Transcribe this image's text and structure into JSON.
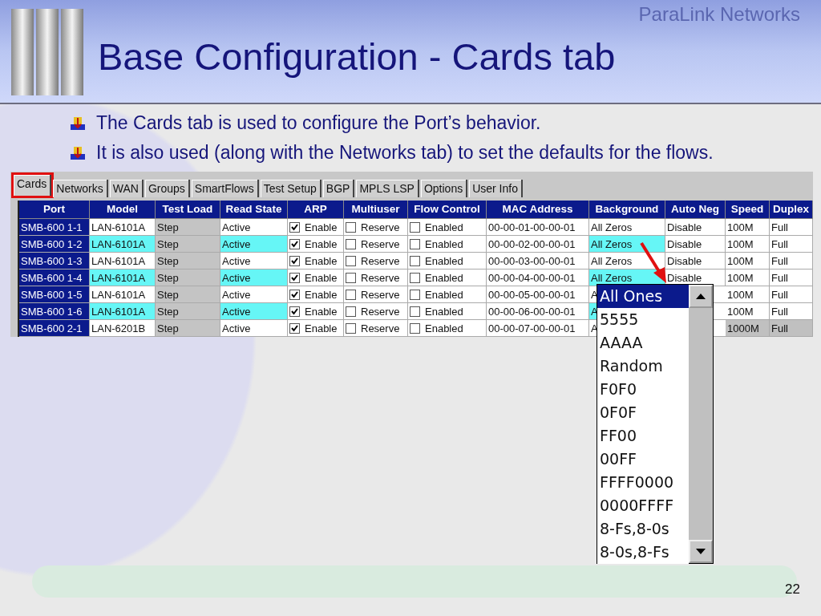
{
  "header": {
    "company": "ParaLink Networks",
    "title": "Base Configuration - Cards tab"
  },
  "bullets": [
    "The Cards tab is used to configure the Port’s behavior.",
    "It is also used (along with the Networks tab) to set the defaults for the flows."
  ],
  "app": {
    "tabs": [
      {
        "label": "Cards",
        "selected": true,
        "highlighted": true
      },
      {
        "label": "Networks",
        "selected": false,
        "highlighted": false
      },
      {
        "label": "WAN",
        "selected": false,
        "highlighted": false
      },
      {
        "label": "Groups",
        "selected": false,
        "highlighted": false
      },
      {
        "label": "SmartFlows",
        "selected": false,
        "highlighted": false
      },
      {
        "label": "Test Setup",
        "selected": false,
        "highlighted": false
      },
      {
        "label": "BGP",
        "selected": false,
        "highlighted": false
      },
      {
        "label": "MPLS LSP",
        "selected": false,
        "highlighted": false
      },
      {
        "label": "Options",
        "selected": false,
        "highlighted": false
      },
      {
        "label": "User Info",
        "selected": false,
        "highlighted": false
      }
    ],
    "table": {
      "columns": [
        "Port",
        "Model",
        "Test Load",
        "Read State",
        "ARP",
        "Multiuser",
        "Flow Control",
        "MAC Address",
        "Background",
        "Auto Neg",
        "Speed",
        "Duplex"
      ],
      "rows": [
        {
          "port": "SMB-600 1-1",
          "model": "LAN-6101A",
          "test_load": "Step",
          "read_state": "Active",
          "arp": {
            "checked": true,
            "label": "Enable"
          },
          "multiuser": {
            "checked": false,
            "label": "Reserve"
          },
          "flow_control": {
            "checked": false,
            "label": "Enabled"
          },
          "mac_address": "00-00-01-00-00-01",
          "background": "All Zeros",
          "auto_neg": "Disable",
          "speed": "100M",
          "duplex": "Full",
          "highlighted": false,
          "selected": false
        },
        {
          "port": "SMB-600 1-2",
          "model": "LAN-6101A",
          "test_load": "Step",
          "read_state": "Active",
          "arp": {
            "checked": true,
            "label": "Enable"
          },
          "multiuser": {
            "checked": false,
            "label": "Reserve"
          },
          "flow_control": {
            "checked": false,
            "label": "Enabled"
          },
          "mac_address": "00-00-02-00-00-01",
          "background": "All Zeros",
          "auto_neg": "Disable",
          "speed": "100M",
          "duplex": "Full",
          "highlighted": true,
          "selected": false
        },
        {
          "port": "SMB-600 1-3",
          "model": "LAN-6101A",
          "test_load": "Step",
          "read_state": "Active",
          "arp": {
            "checked": true,
            "label": "Enable"
          },
          "multiuser": {
            "checked": false,
            "label": "Reserve"
          },
          "flow_control": {
            "checked": false,
            "label": "Enabled"
          },
          "mac_address": "00-00-03-00-00-01",
          "background": "All Zeros",
          "auto_neg": "Disable",
          "speed": "100M",
          "duplex": "Full",
          "highlighted": false,
          "selected": false
        },
        {
          "port": "SMB-600 1-4",
          "model": "LAN-6101A",
          "test_load": "Step",
          "read_state": "Active",
          "arp": {
            "checked": true,
            "label": "Enable"
          },
          "multiuser": {
            "checked": false,
            "label": "Reserve"
          },
          "flow_control": {
            "checked": false,
            "label": "Enabled"
          },
          "mac_address": "00-00-04-00-00-01",
          "background": "All Zeros",
          "auto_neg": "Disable",
          "speed": "100M",
          "duplex": "Full",
          "highlighted": true,
          "selected": false
        },
        {
          "port": "SMB-600 1-5",
          "model": "LAN-6101A",
          "test_load": "Step",
          "read_state": "Active",
          "arp": {
            "checked": true,
            "label": "Enable"
          },
          "multiuser": {
            "checked": false,
            "label": "Reserve"
          },
          "flow_control": {
            "checked": false,
            "label": "Enabled"
          },
          "mac_address": "00-00-05-00-00-01",
          "background": "A",
          "speed": "100M",
          "duplex": "Full",
          "highlighted": false,
          "selected": false
        },
        {
          "port": "SMB-600 1-6",
          "model": "LAN-6101A",
          "test_load": "Step",
          "read_state": "Active",
          "arp": {
            "checked": true,
            "label": "Enable"
          },
          "multiuser": {
            "checked": false,
            "label": "Reserve"
          },
          "flow_control": {
            "checked": false,
            "label": "Enabled"
          },
          "mac_address": "00-00-06-00-00-01",
          "background": "A",
          "speed": "100M",
          "duplex": "Full",
          "highlighted": true,
          "selected": false
        },
        {
          "port": "SMB-600 2-1",
          "model": "LAN-6201B",
          "test_load": "Step",
          "read_state": "Active",
          "arp": {
            "checked": true,
            "label": "Enable"
          },
          "multiuser": {
            "checked": false,
            "label": "Reserve"
          },
          "flow_control": {
            "checked": false,
            "label": "Enabled"
          },
          "mac_address": "00-00-07-00-00-01",
          "background": "A",
          "speed": "1000M",
          "duplex": "Full",
          "highlighted": false,
          "selected": true
        }
      ]
    },
    "dropdown": {
      "items": [
        {
          "label": "All Ones",
          "selected": true
        },
        {
          "label": "5555",
          "selected": false
        },
        {
          "label": "AAAA",
          "selected": false
        },
        {
          "label": "Random",
          "selected": false
        },
        {
          "label": "F0F0",
          "selected": false
        },
        {
          "label": "0F0F",
          "selected": false
        },
        {
          "label": "FF00",
          "selected": false
        },
        {
          "label": "00FF",
          "selected": false
        },
        {
          "label": "FFFF0000",
          "selected": false
        },
        {
          "label": "0000FFFF",
          "selected": false
        },
        {
          "label": "8-Fs,8-0s",
          "selected": false
        },
        {
          "label": "8-0s,8-Fs",
          "selected": false
        }
      ]
    }
  },
  "page_number": "22"
}
